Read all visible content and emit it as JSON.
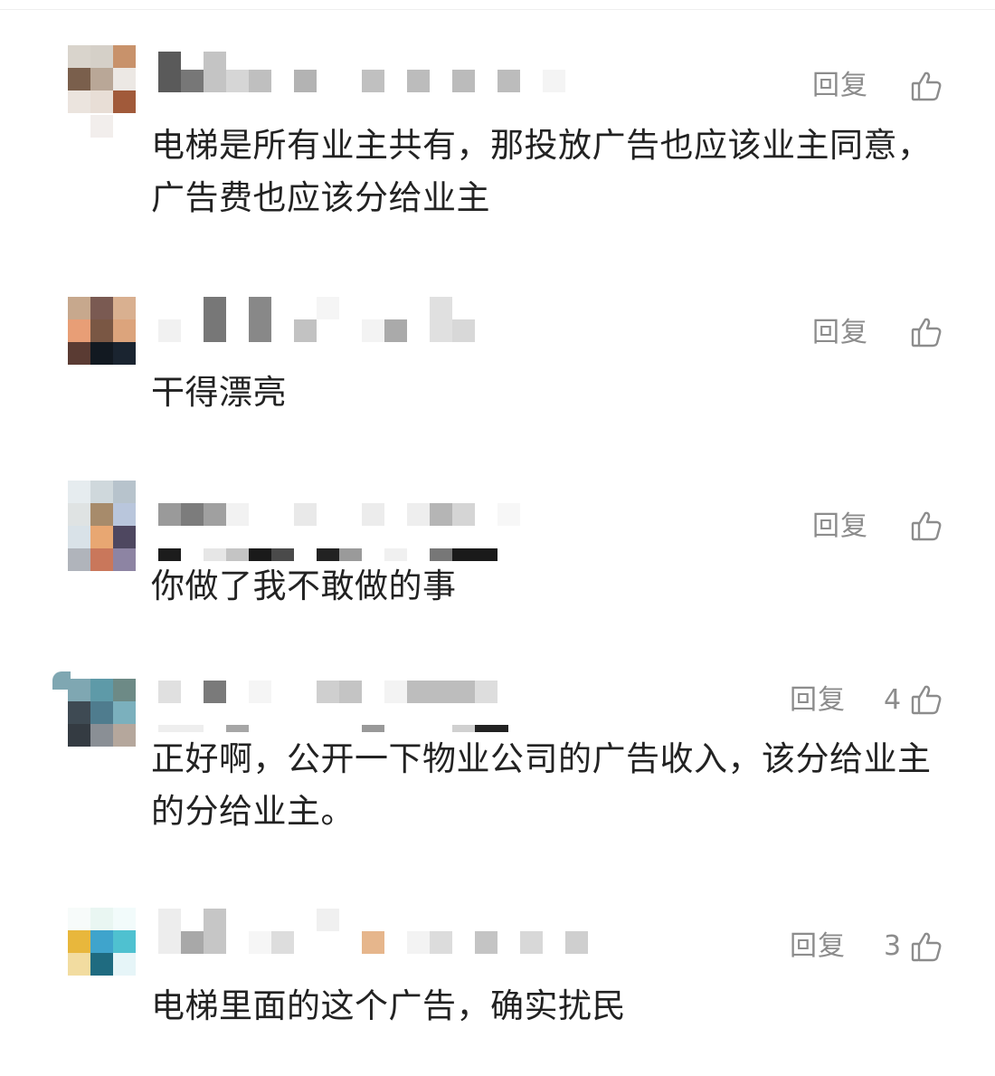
{
  "comments": [
    {
      "text": "电梯是所有业主共有，那投放广告也应该业主同意，广告费也应该分给业主",
      "reply_label": "回复",
      "like_count": "",
      "avatar": [
        "#d9d4cc",
        "#d5d0c8",
        "#c8926b",
        "#7a5f4c",
        "#b9a797",
        "#ece8e4",
        "#ebe4de",
        "#e8ded6",
        "#a15a3a"
      ]
    },
    {
      "text": "干得漂亮",
      "reply_label": "回复",
      "like_count": "",
      "avatar": [
        "#c7a88d",
        "#7a5a52",
        "#d9b090",
        "#e89e76",
        "#7a5744",
        "#dca47c",
        "#5a3b33",
        "#121921",
        "#1a2430"
      ]
    },
    {
      "text": "你做了我不敢做的事",
      "reply_label": "回复",
      "like_count": "",
      "avatar": [
        "#e6ecef",
        "#cfd8dc",
        "#b7c3cc",
        "#dfe3e3",
        "#a78b6b",
        "#b9c6dc",
        "#d9e2e8",
        "#e8a772",
        "#4e4760",
        "#b0b4bb",
        "#c9775b",
        "#8d84a3"
      ]
    },
    {
      "text": "正好啊，公开一下物业公司的广告收入，该分给业主的分给业主。",
      "reply_label": "回复",
      "like_count": "4",
      "avatar": [
        "#7fa7b2",
        "#5e9aa8",
        "#6d8a86",
        "#3e4a53",
        "#4f7c8e",
        "#7bb0bd",
        "#343b42",
        "#8a8f95",
        "#b5a79c"
      ]
    },
    {
      "text": "电梯里面的这个广告，确实扰民",
      "reply_label": "回复",
      "like_count": "3",
      "avatar": [
        "#f7fbfa",
        "#e9f6f2",
        "#f2fbfb",
        "#e8b73c",
        "#3fa4cc",
        "#4fc1d0",
        "#f2dca0",
        "#1f6b80",
        "#e6f5f8"
      ]
    }
  ]
}
